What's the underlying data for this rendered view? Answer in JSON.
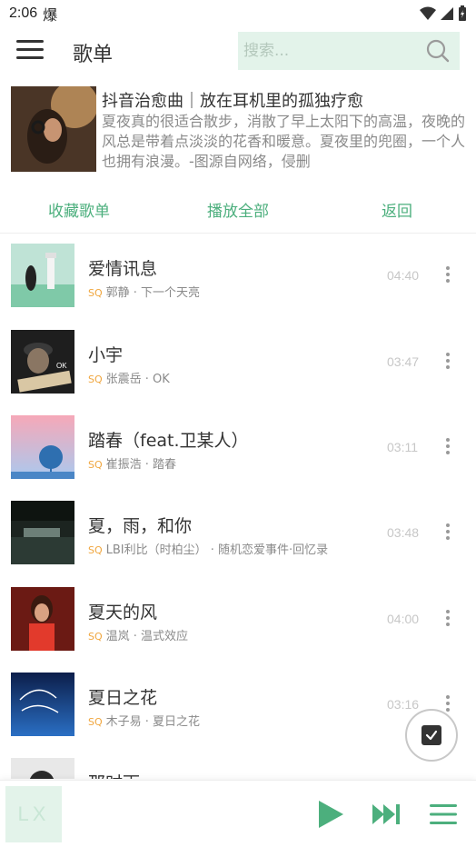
{
  "status_bar": {
    "time": "2:06",
    "app_glyph": "爆"
  },
  "header": {
    "title": "歌单",
    "search_placeholder": "搜索..."
  },
  "playlist": {
    "title": "抖音治愈曲｜放在耳机里的孤独疗愈",
    "description": "夏夜真的很适合散步，消散了早上太阳下的高温，夜晚的风总是带着点淡淡的花香和暖意。夏夜里的兜圈，一个人也拥有浪漫。-图源自网络，侵删"
  },
  "actions": {
    "collect": "收藏歌单",
    "play_all": "播放全部",
    "back": "返回"
  },
  "songs": [
    {
      "name": "爱情讯息",
      "quality": "SQ",
      "meta": "郭静 · 下一个天亮",
      "duration": "04:40"
    },
    {
      "name": "小宇",
      "quality": "SQ",
      "meta": "张震岳 · OK",
      "duration": "03:47"
    },
    {
      "name": "踏春（feat.卫某人）",
      "quality": "SQ",
      "meta": "崔振浩 · 踏春",
      "duration": "03:11"
    },
    {
      "name": "夏，雨，和你",
      "quality": "SQ",
      "meta": "LBI利比（时柏尘） · 随机恋爱事件·回忆录",
      "duration": "03:48"
    },
    {
      "name": "夏天的风",
      "quality": "SQ",
      "meta": "温岚 · 温式效应",
      "duration": "04:00"
    },
    {
      "name": "夏日之花",
      "quality": "SQ",
      "meta": "木子易 · 夏日之花",
      "duration": "03:16"
    },
    {
      "name": "那时雨",
      "quality": "",
      "meta": "",
      "duration": ""
    }
  ],
  "player": {
    "logo": "LX"
  },
  "colors": {
    "accent": "#4caf7d",
    "search_bg": "#e3f3ea",
    "quality_badge": "#f0a63e"
  }
}
